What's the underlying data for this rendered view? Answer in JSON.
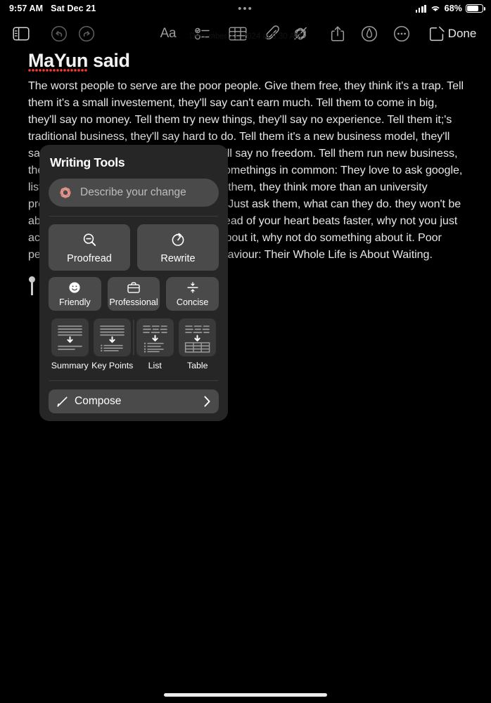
{
  "status_bar": {
    "time": "9:57 AM",
    "date": "Sat Dec 21",
    "recording_indicator": "•••",
    "battery_percent": "68%",
    "cellular_icon": "signal-bars-icon",
    "wifi_icon": "wifi-icon",
    "battery_icon": "battery-icon"
  },
  "toolbar": {
    "sidebar_label": "sidebar-toggle",
    "undo_label": "undo",
    "redo_label": "redo",
    "format_label": "Aa",
    "checklist_label": "checklist",
    "table_label": "table",
    "attachment_label": "attachment",
    "markup_label": "markup",
    "share_label": "share",
    "highlighter_label": "highlighter",
    "more_label": "more",
    "compose_label": "new-note",
    "done_label": "Done"
  },
  "document": {
    "title_misspelled": "MaYun",
    "title_rest": " said",
    "date_stamp": "December 21, 2024 at 9:30 AM",
    "body": "The worst people to serve are the poor people. Give them free, they think it's a trap. Tell them it's a small investement, they'll say can't earn much. Tell them to come in big, they'll say no money. Tell them try new things, they'll say no experience. Tell them it;'s traditional business, they'll say hard to do. Tell them it's a new business model, they'll say it's MLM. Tell them run a shop, they'll say no freedom. Tell them run new business, they'll say no expertise. They do have somethings in common: They love to ask google, listen to friends who are as hopeless as them, they think more than an university professor and do less than a blind man. Just ask them, what can they do. they won't be able to answer you. My conclusion: Instead of your heart beats faster, why not you just act faster a bit; instead of just thinking about it, why not do something about it. Poor people fail because of one common behaviour: Their Whole Life is About Waiting."
  },
  "writing_tools": {
    "title": "Writing Tools",
    "describe_placeholder": "Describe your change",
    "describe_value": "",
    "sparkle_icon": "apple-intelligence-icon",
    "primary_actions": [
      {
        "label": "Proofread",
        "icon": "magnifier-minus-icon"
      },
      {
        "label": "Rewrite",
        "icon": "rewrite-clock-icon"
      }
    ],
    "tone_actions": [
      {
        "label": "Friendly",
        "icon": "smiley-face-icon"
      },
      {
        "label": "Professional",
        "icon": "briefcase-icon"
      },
      {
        "label": "Concise",
        "icon": "compress-arrows-icon"
      }
    ],
    "format_actions": [
      {
        "label": "Summary",
        "icon": "summary-doc-icon"
      },
      {
        "label": "Key Points",
        "icon": "key-points-doc-icon"
      },
      {
        "label": "List",
        "icon": "list-doc-icon"
      },
      {
        "label": "Table",
        "icon": "table-doc-icon"
      }
    ],
    "compose": {
      "label": "Compose",
      "icon": "pencil-icon",
      "chevron": "chevron-right-icon"
    }
  },
  "colors": {
    "background": "#000000",
    "panel": "#262626",
    "control": "#4a4a4a",
    "card": "#3a3a3a",
    "text": "#ffffff",
    "misspell_underline": "#ff3b30",
    "accent_pink": "#e8908d"
  }
}
